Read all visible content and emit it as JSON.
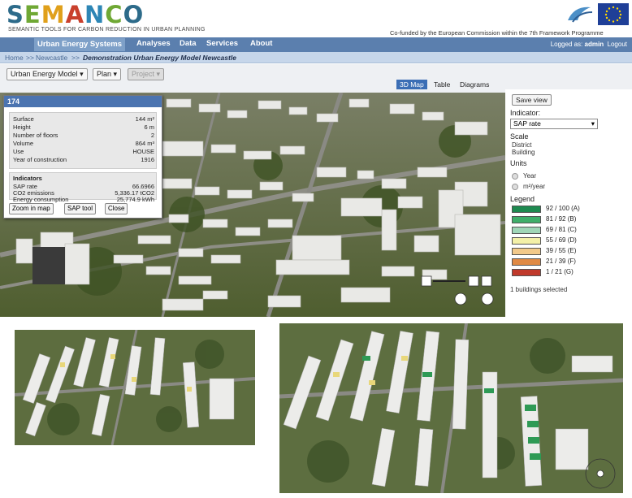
{
  "header": {
    "logo": "SEMANCO",
    "tagline": "SEMANTIC TOOLS FOR CARBON REDUCTION IN URBAN PLANNING",
    "cofunded": "Co-funded by the European Commission within the 7th Framework Programme"
  },
  "nav": {
    "home_label": "Home",
    "items": [
      "Urban Energy Systems",
      "Analyses",
      "Data",
      "Services",
      "About"
    ],
    "logged_prefix": "Logged as:",
    "user": "admin",
    "logout": "Logout"
  },
  "breadcrumb": {
    "items": [
      "Home",
      ">>",
      "Newcastle",
      ">>"
    ],
    "current": "Demonstration Urban Energy Model Newcastle"
  },
  "toolbar": {
    "model_dropdown": "Urban Energy Model",
    "plan_dropdown": "Plan",
    "project_dropdown": "Project",
    "tabs": [
      "3D Map",
      "Table",
      "Diagrams"
    ]
  },
  "popup": {
    "title": "174",
    "properties": [
      {
        "label": "Surface",
        "value": "144 m²"
      },
      {
        "label": "Height",
        "value": "6 m"
      },
      {
        "label": "Number of floors",
        "value": "2"
      },
      {
        "label": "Volume",
        "value": "864 m³"
      },
      {
        "label": "Use",
        "value": "HOUSE"
      },
      {
        "label": "Year of construction",
        "value": "1916"
      }
    ],
    "indicators_heading": "Indicators",
    "indicators": [
      {
        "label": "SAP rate",
        "value": "66.6966"
      },
      {
        "label": "CO2 emissions",
        "value": "5,336.17 tCO2"
      },
      {
        "label": "Energy consumption",
        "value": "25,774.9 kWh"
      }
    ],
    "buttons": [
      "Zoom in map",
      "SAP tool",
      "Close"
    ]
  },
  "sidebar": {
    "save_view": "Save view",
    "indicator_label": "Indicator:",
    "indicator_value": "SAP rate",
    "scale_label": "Scale",
    "scale_options": [
      "District",
      "Building"
    ],
    "units_label": "Units",
    "unit_options": [
      "Year",
      "m²/year"
    ],
    "legend_label": "Legend",
    "legend": [
      {
        "label": "92 / 100 (A)",
        "color": "#1e8a50"
      },
      {
        "label": "81 / 92 (B)",
        "color": "#3fae6a"
      },
      {
        "label": "69 / 81 (C)",
        "color": "#9fd6b8"
      },
      {
        "label": "55 / 69 (D)",
        "color": "#f3f0a8"
      },
      {
        "label": "39 / 55 (E)",
        "color": "#f2c98a"
      },
      {
        "label": "21 / 39 (F)",
        "color": "#e08a45"
      },
      {
        "label": "1 / 21 (G)",
        "color": "#c0392b"
      }
    ],
    "selected_text": "1 buildings selected"
  },
  "colors": {
    "nav_bg": "#5b7fae",
    "accent": "#3b6eb5"
  }
}
